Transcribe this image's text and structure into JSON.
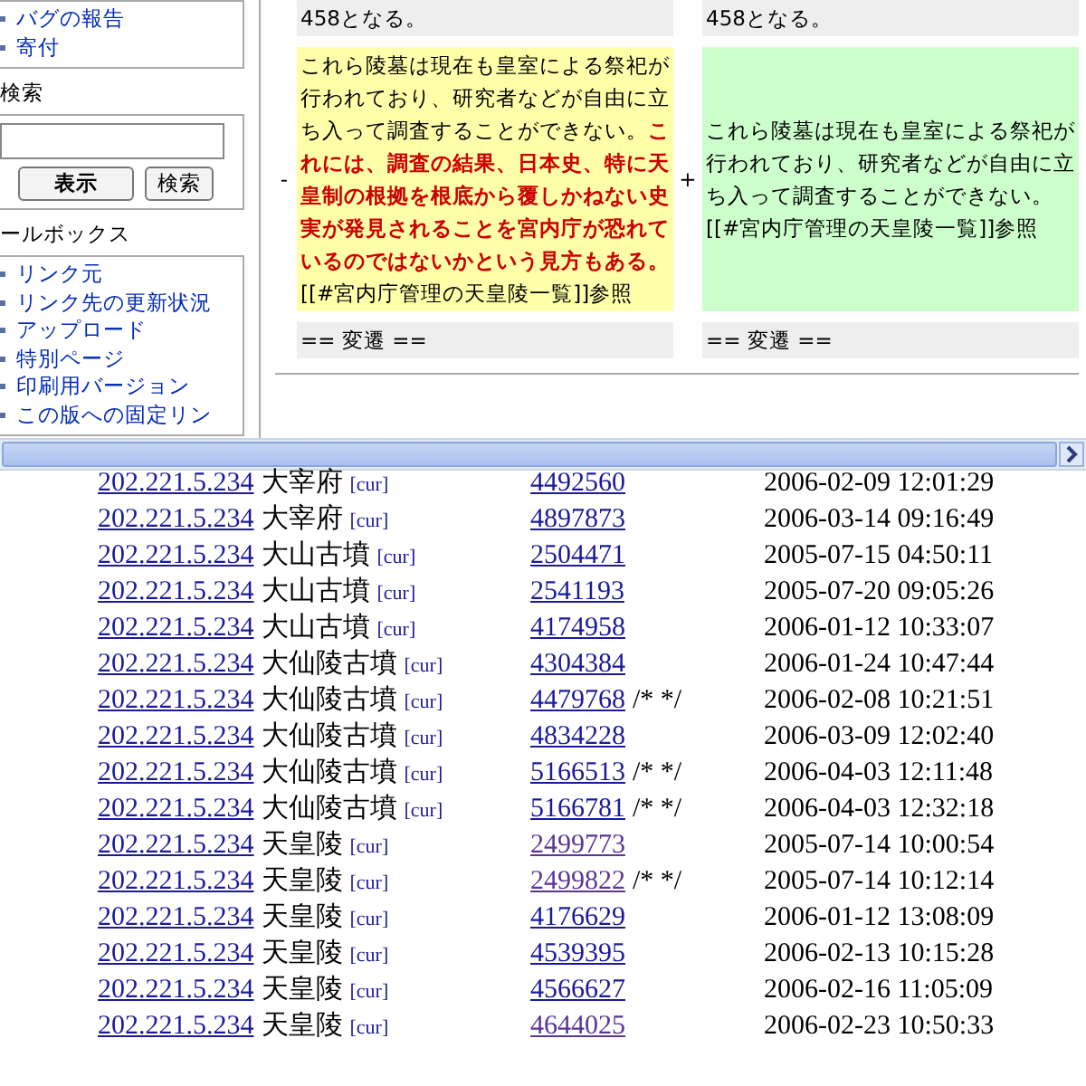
{
  "sidebar": {
    "nav_items": [
      "バグの報告",
      "寄付"
    ],
    "search": {
      "heading": "検索",
      "buttons": [
        {
          "label": "表示",
          "kind": "primary"
        },
        {
          "label": "検索",
          "kind": "secondary"
        }
      ]
    },
    "toolbox": {
      "heading": "ールボックス",
      "items": [
        "リンク元",
        "リンク先の更新状況",
        "アップロード",
        "特別ページ",
        "印刷用バージョン",
        "この版への固定リン"
      ]
    }
  },
  "diff": {
    "rows": [
      {
        "kind": "context",
        "left": "458となる。",
        "right": "458となる。"
      },
      {
        "kind": "change",
        "left_marker": "-",
        "right_marker": "+",
        "left": "これら陵墓は現在も皇室による祭祀が行われており、研究者などが自由に立ち入って調査することができない。**これには、調査の結果、日本史、特に天皇制の根拠を根底から覆しかねない史実が発見されることを宮内庁が恐れているのではないかという見方もある。**[[#宮内庁管理の天皇陵一覧]]参照",
        "right": "これら陵墓は現在も皇室による祭祀が行われており、研究者などが自由に立ち入って調査することができない。[[#宮内庁管理の天皇陵一覧]]参照"
      },
      {
        "kind": "context",
        "left": "== 変遷 ==",
        "right": "== 変遷 =="
      }
    ]
  },
  "edits": [
    {
      "ip": "202.221.5.234",
      "page": "大宰府",
      "cur": "[cur]",
      "rev": "4492560",
      "visited": false,
      "date": "2006-02-09 12:01:29"
    },
    {
      "ip": "202.221.5.234",
      "page": "大宰府",
      "cur": "[cur]",
      "rev": "4897873",
      "visited": false,
      "date": "2006-03-14 09:16:49"
    },
    {
      "ip": "202.221.5.234",
      "page": "大山古墳",
      "cur": "[cur]",
      "rev": "2504471",
      "visited": false,
      "date": "2005-07-15 04:50:11"
    },
    {
      "ip": "202.221.5.234",
      "page": "大山古墳",
      "cur": "[cur]",
      "rev": "2541193",
      "visited": false,
      "date": "2005-07-20 09:05:26"
    },
    {
      "ip": "202.221.5.234",
      "page": "大山古墳",
      "cur": "[cur]",
      "rev": "4174958",
      "visited": false,
      "date": "2006-01-12 10:33:07"
    },
    {
      "ip": "202.221.5.234",
      "page": "大仙陵古墳",
      "cur": "[cur]",
      "rev": "4304384",
      "visited": false,
      "date": "2006-01-24 10:47:44"
    },
    {
      "ip": "202.221.5.234",
      "page": "大仙陵古墳",
      "cur": "[cur]",
      "rev": "4479768",
      "visited": false,
      "comment": "/* */",
      "date": "2006-02-08 10:21:51"
    },
    {
      "ip": "202.221.5.234",
      "page": "大仙陵古墳",
      "cur": "[cur]",
      "rev": "4834228",
      "visited": false,
      "date": "2006-03-09 12:02:40"
    },
    {
      "ip": "202.221.5.234",
      "page": "大仙陵古墳",
      "cur": "[cur]",
      "rev": "5166513",
      "visited": false,
      "comment": "/* */",
      "date": "2006-04-03 12:11:48"
    },
    {
      "ip": "202.221.5.234",
      "page": "大仙陵古墳",
      "cur": "[cur]",
      "rev": "5166781",
      "visited": false,
      "comment": "/* */",
      "date": "2006-04-03 12:32:18"
    },
    {
      "ip": "202.221.5.234",
      "page": "天皇陵",
      "cur": "[cur]",
      "rev": "2499773",
      "visited": true,
      "date": "2005-07-14 10:00:54"
    },
    {
      "ip": "202.221.5.234",
      "page": "天皇陵",
      "cur": "[cur]",
      "rev": "2499822",
      "visited": true,
      "comment": "/* */",
      "date": "2005-07-14 10:12:14"
    },
    {
      "ip": "202.221.5.234",
      "page": "天皇陵",
      "cur": "[cur]",
      "rev": "4176629",
      "visited": false,
      "date": "2006-01-12 13:08:09"
    },
    {
      "ip": "202.221.5.234",
      "page": "天皇陵",
      "cur": "[cur]",
      "rev": "4539395",
      "visited": false,
      "date": "2006-02-13 10:15:28"
    },
    {
      "ip": "202.221.5.234",
      "page": "天皇陵",
      "cur": "[cur]",
      "rev": "4566627",
      "visited": false,
      "date": "2006-02-16 11:05:09"
    },
    {
      "ip": "202.221.5.234",
      "page": "天皇陵",
      "cur": "[cur]",
      "rev": "4644025",
      "visited": true,
      "date": "2006-02-23 10:50:33"
    }
  ]
}
